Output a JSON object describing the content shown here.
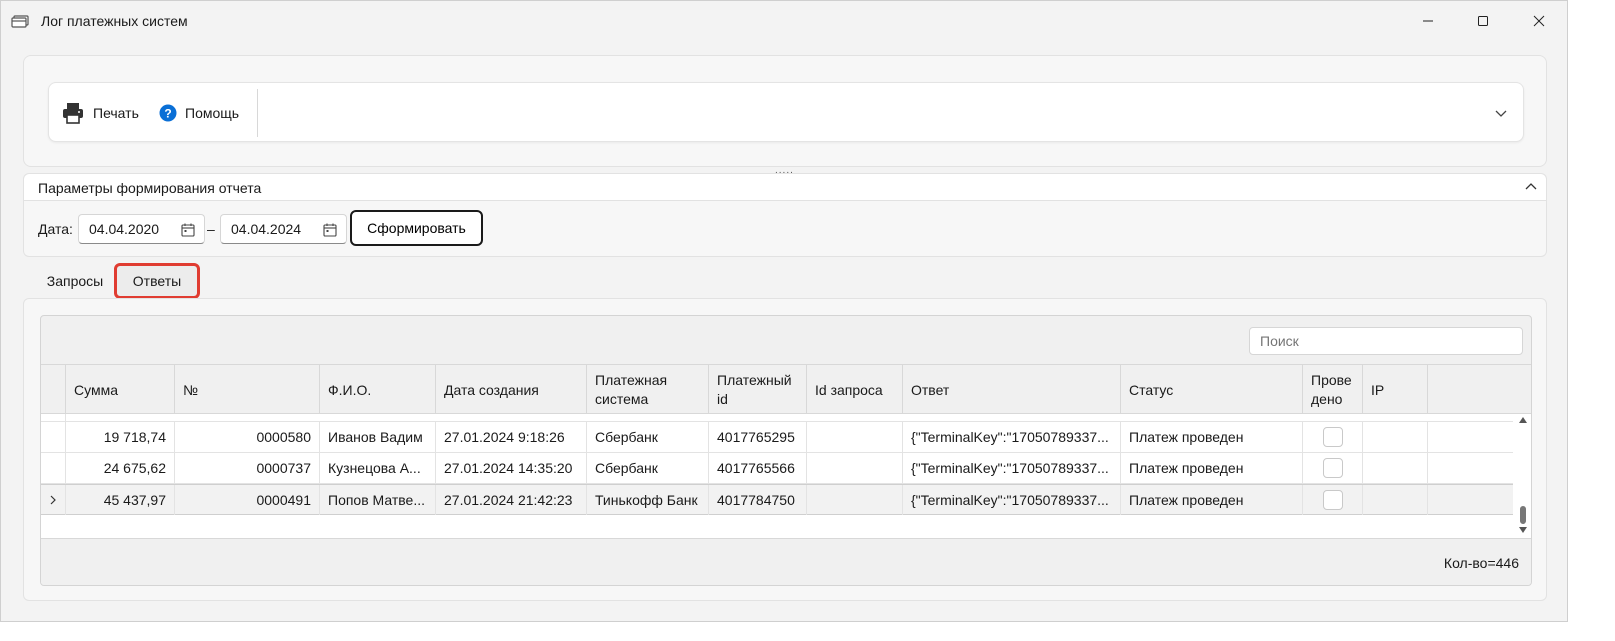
{
  "window": {
    "title": "Лог платежных систем",
    "icon": "payment-card-icon"
  },
  "toolbar": {
    "print_label": "Печать",
    "help_label": "Помощь"
  },
  "params": {
    "title": "Параметры формирования отчета",
    "date_label": "Дата:",
    "date_from": "04.04.2020",
    "date_separator": "–",
    "date_to": "04.04.2024",
    "generate_label": "Сформировать"
  },
  "tabs": [
    {
      "label": "Запросы"
    },
    {
      "label": "Ответы"
    }
  ],
  "grid": {
    "search_placeholder": "Поиск",
    "columns": [
      "Сумма",
      "№",
      "Ф.И.О.",
      "Дата создания",
      "Платежная система",
      "Платежный id",
      "Id запроса",
      "Ответ",
      "Статус",
      "Прове дено",
      "IP"
    ],
    "rows": [
      [
        "19 718,74",
        "0000580",
        "Иванов Вадим",
        "27.01.2024 9:18:26",
        "Сбербанк",
        "4017765295",
        "",
        "{\"TerminalKey\":\"17050789337...",
        "Платеж проведен",
        "",
        ""
      ],
      [
        "24 675,62",
        "0000737",
        "Кузнецова А...",
        "27.01.2024 14:35:20",
        "Сбербанк",
        "4017765566",
        "",
        "{\"TerminalKey\":\"17050789337...",
        "Платеж проведен",
        "",
        ""
      ],
      [
        "45 437,97",
        "0000491",
        "Попов Матве...",
        "27.01.2024 21:42:23",
        "Тинькофф Банк",
        "4017784750",
        "",
        "{\"TerminalKey\":\"17050789337...",
        "Платеж проведен",
        "",
        ""
      ]
    ],
    "count": "Кол-во=446"
  }
}
